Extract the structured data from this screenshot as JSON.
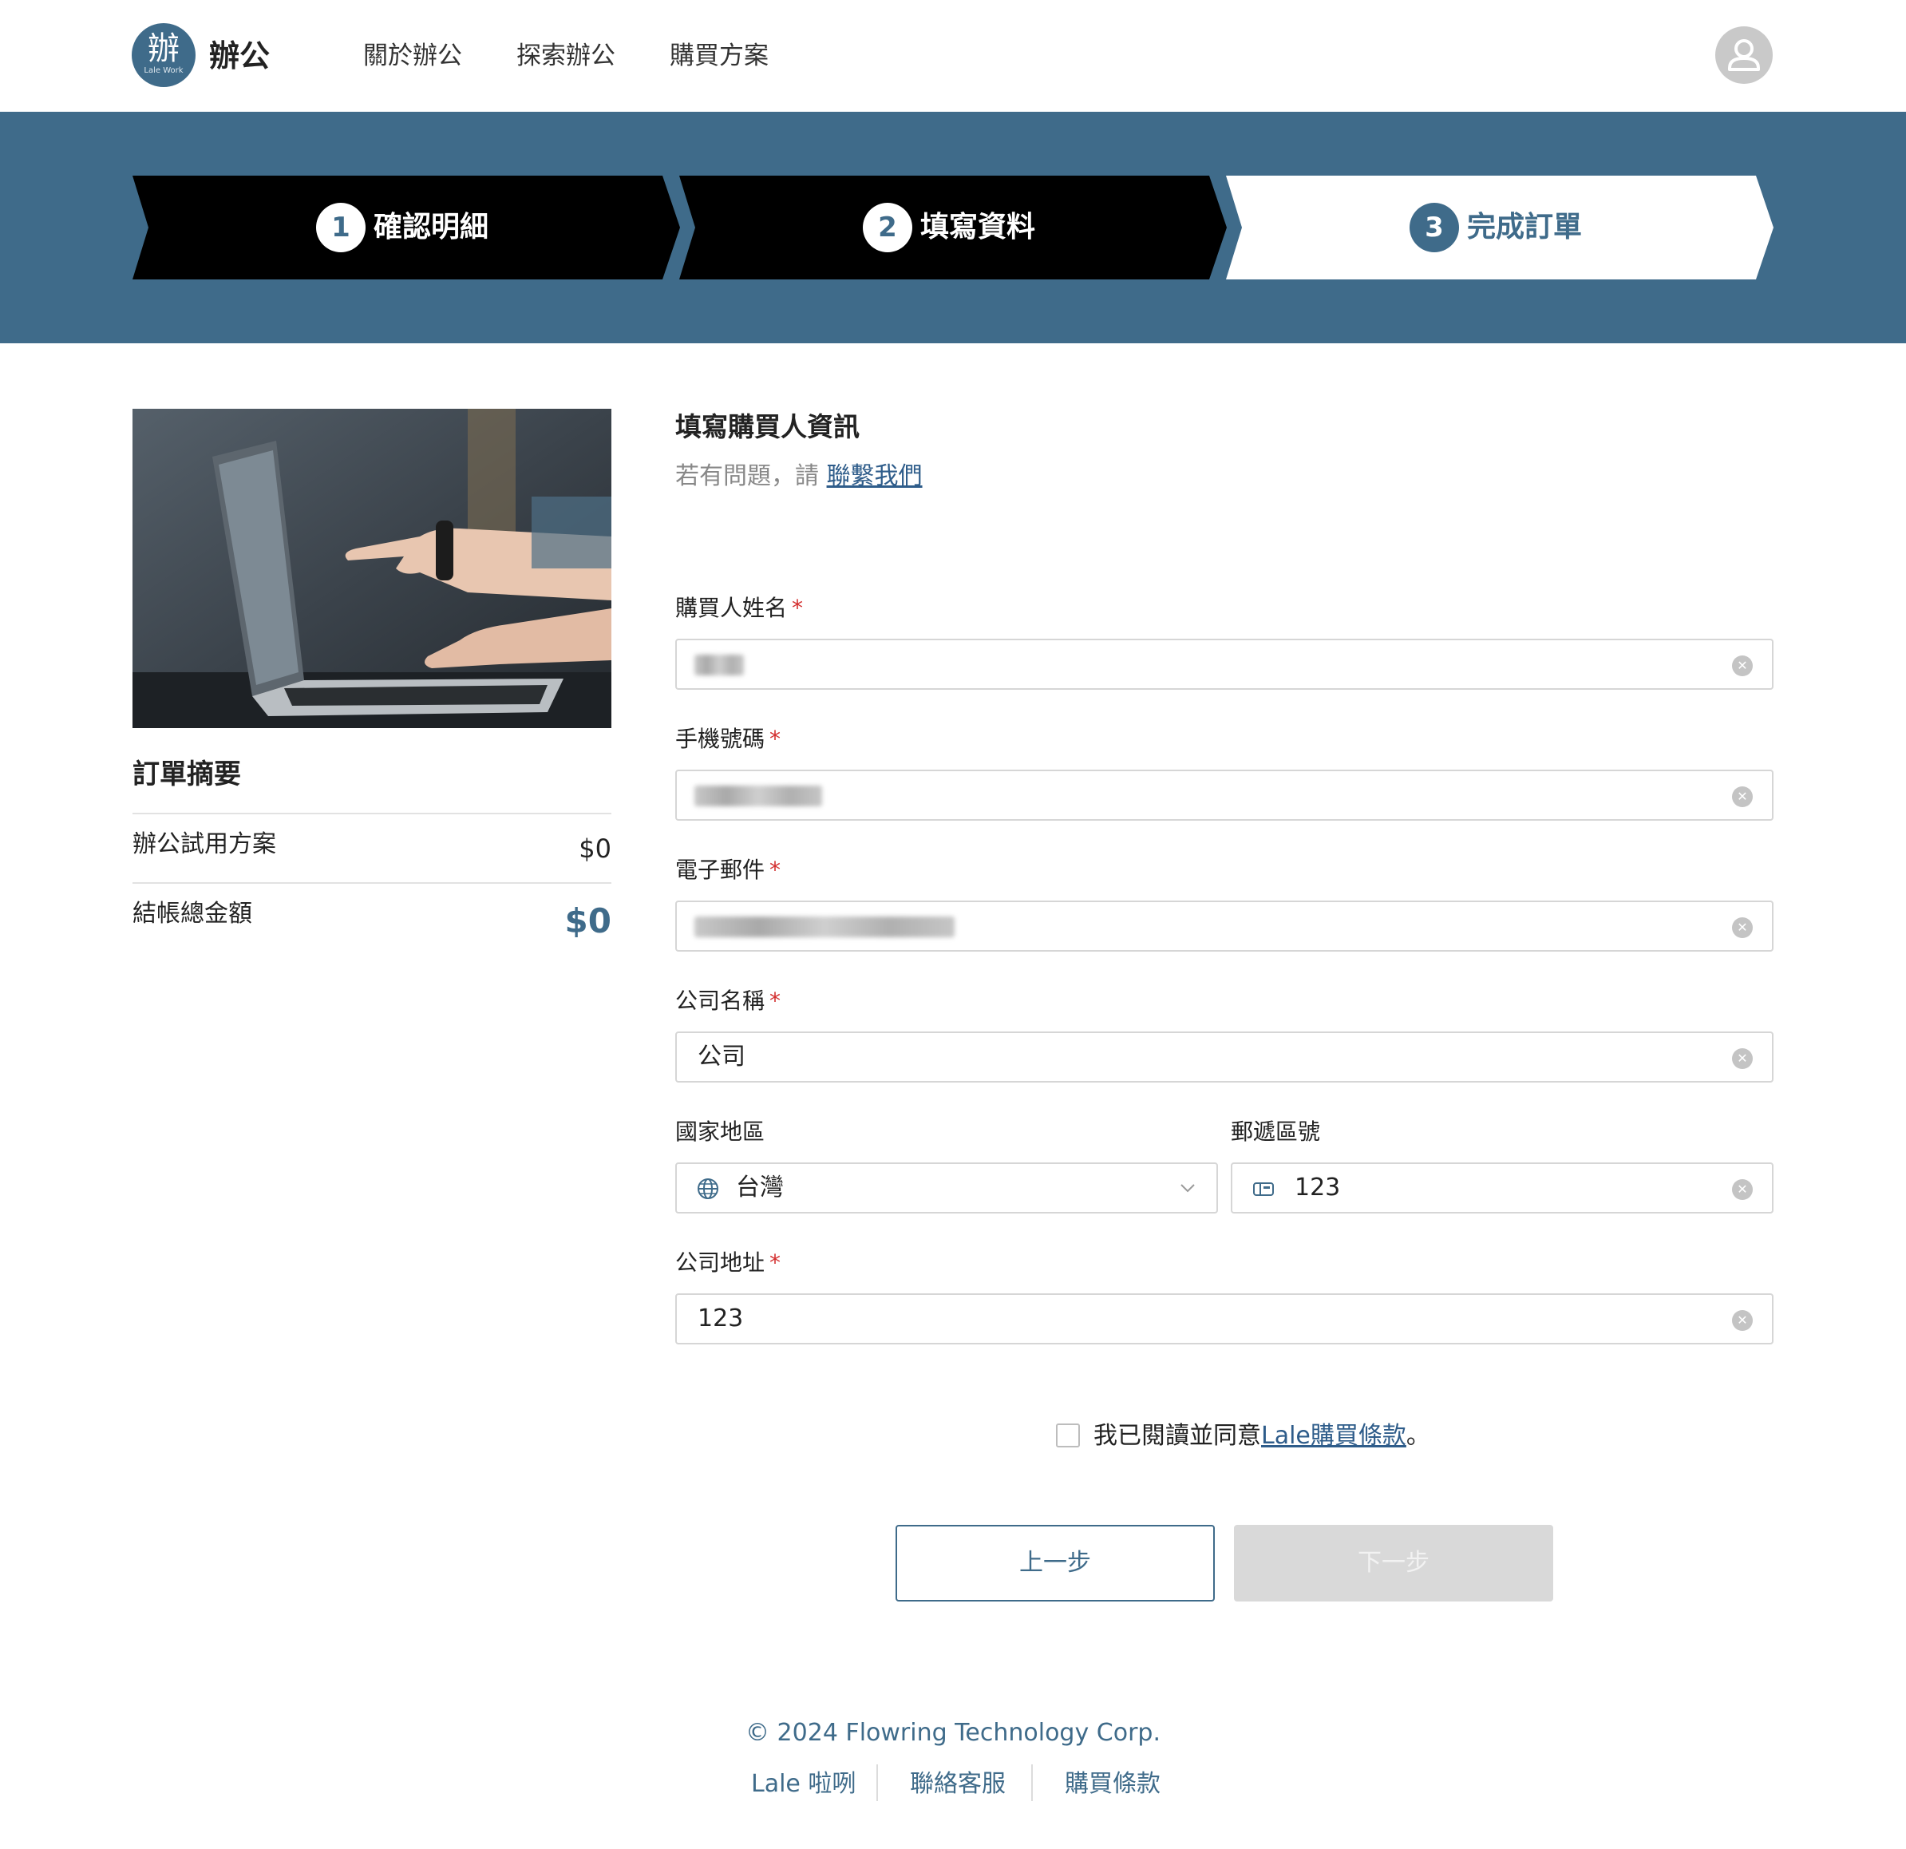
{
  "brand": {
    "logo_glyph": "辦",
    "logo_sub": "Lale Work",
    "name": "辦公"
  },
  "nav": {
    "items": [
      "關於辦公",
      "探索辦公",
      "購買方案"
    ]
  },
  "icons": {
    "avatar": "user-icon",
    "clear": "close-circle-icon",
    "country": "globe-icon",
    "postal": "mailbox-icon",
    "dropdown": "chevron-down-icon"
  },
  "colors": {
    "accent": "#3f6b8a",
    "step_done_bg": "#000000",
    "step_active_bg": "#ffffff",
    "required": "#d32f2f",
    "disabled_button": "#d9d9d9"
  },
  "stepper": {
    "steps": [
      {
        "number": "1",
        "label": "確認明細",
        "state": "done"
      },
      {
        "number": "2",
        "label": "填寫資料",
        "state": "done"
      },
      {
        "number": "3",
        "label": "完成訂單",
        "state": "active"
      }
    ]
  },
  "summary": {
    "title": "訂單摘要",
    "rows": [
      {
        "label": "辦公試用方案",
        "value": "$0"
      },
      {
        "label": "結帳總金額",
        "value": "$0"
      }
    ]
  },
  "form": {
    "title": "填寫購買人資訊",
    "subtitle_prefix": "若有問題，請",
    "subtitle_link": "聯繫我們",
    "required_mark": "*",
    "fields": {
      "buyer_name": {
        "label": "購買人姓名",
        "value": "",
        "redacted": true
      },
      "phone": {
        "label": "手機號碼",
        "value": "",
        "redacted": true
      },
      "email": {
        "label": "電子郵件",
        "value": "",
        "redacted": true
      },
      "company": {
        "label": "公司名稱",
        "value": "公司"
      },
      "country": {
        "label": "國家地區",
        "value": "台灣"
      },
      "postal": {
        "label": "郵遞區號",
        "value": "123"
      },
      "address": {
        "label": "公司地址",
        "value": "123"
      }
    },
    "agree_prefix": "我已閱讀並同意",
    "agree_link": "Lale購買條款",
    "agree_suffix": "。",
    "agree_checked": false,
    "prev_label": "上一步",
    "next_label": "下一步"
  },
  "footer": {
    "copyright": "© 2024 Flowring Technology Corp.",
    "links": [
      "Lale 啦咧",
      "聯絡客服",
      "購買條款"
    ]
  }
}
